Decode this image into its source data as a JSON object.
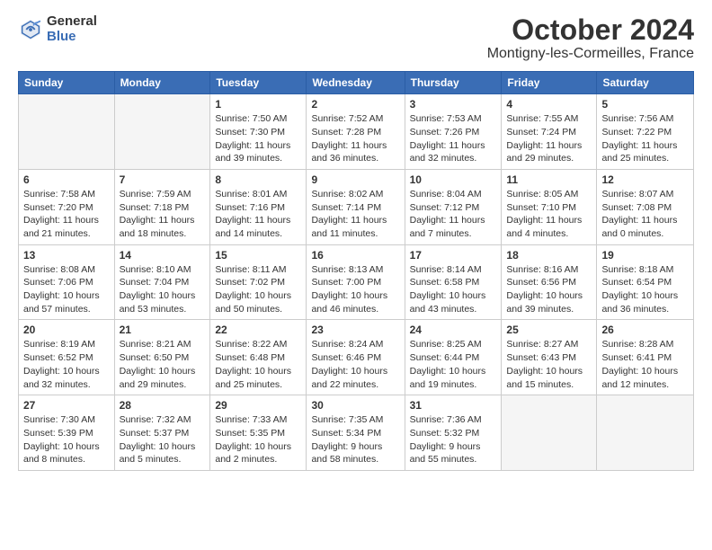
{
  "logo": {
    "general": "General",
    "blue": "Blue"
  },
  "header": {
    "month": "October 2024",
    "location": "Montigny-les-Cormeilles, France"
  },
  "weekdays": [
    "Sunday",
    "Monday",
    "Tuesday",
    "Wednesday",
    "Thursday",
    "Friday",
    "Saturday"
  ],
  "weeks": [
    [
      {
        "day": "",
        "info": ""
      },
      {
        "day": "",
        "info": ""
      },
      {
        "day": "1",
        "info": "Sunrise: 7:50 AM\nSunset: 7:30 PM\nDaylight: 11 hours and 39 minutes."
      },
      {
        "day": "2",
        "info": "Sunrise: 7:52 AM\nSunset: 7:28 PM\nDaylight: 11 hours and 36 minutes."
      },
      {
        "day": "3",
        "info": "Sunrise: 7:53 AM\nSunset: 7:26 PM\nDaylight: 11 hours and 32 minutes."
      },
      {
        "day": "4",
        "info": "Sunrise: 7:55 AM\nSunset: 7:24 PM\nDaylight: 11 hours and 29 minutes."
      },
      {
        "day": "5",
        "info": "Sunrise: 7:56 AM\nSunset: 7:22 PM\nDaylight: 11 hours and 25 minutes."
      }
    ],
    [
      {
        "day": "6",
        "info": "Sunrise: 7:58 AM\nSunset: 7:20 PM\nDaylight: 11 hours and 21 minutes."
      },
      {
        "day": "7",
        "info": "Sunrise: 7:59 AM\nSunset: 7:18 PM\nDaylight: 11 hours and 18 minutes."
      },
      {
        "day": "8",
        "info": "Sunrise: 8:01 AM\nSunset: 7:16 PM\nDaylight: 11 hours and 14 minutes."
      },
      {
        "day": "9",
        "info": "Sunrise: 8:02 AM\nSunset: 7:14 PM\nDaylight: 11 hours and 11 minutes."
      },
      {
        "day": "10",
        "info": "Sunrise: 8:04 AM\nSunset: 7:12 PM\nDaylight: 11 hours and 7 minutes."
      },
      {
        "day": "11",
        "info": "Sunrise: 8:05 AM\nSunset: 7:10 PM\nDaylight: 11 hours and 4 minutes."
      },
      {
        "day": "12",
        "info": "Sunrise: 8:07 AM\nSunset: 7:08 PM\nDaylight: 11 hours and 0 minutes."
      }
    ],
    [
      {
        "day": "13",
        "info": "Sunrise: 8:08 AM\nSunset: 7:06 PM\nDaylight: 10 hours and 57 minutes."
      },
      {
        "day": "14",
        "info": "Sunrise: 8:10 AM\nSunset: 7:04 PM\nDaylight: 10 hours and 53 minutes."
      },
      {
        "day": "15",
        "info": "Sunrise: 8:11 AM\nSunset: 7:02 PM\nDaylight: 10 hours and 50 minutes."
      },
      {
        "day": "16",
        "info": "Sunrise: 8:13 AM\nSunset: 7:00 PM\nDaylight: 10 hours and 46 minutes."
      },
      {
        "day": "17",
        "info": "Sunrise: 8:14 AM\nSunset: 6:58 PM\nDaylight: 10 hours and 43 minutes."
      },
      {
        "day": "18",
        "info": "Sunrise: 8:16 AM\nSunset: 6:56 PM\nDaylight: 10 hours and 39 minutes."
      },
      {
        "day": "19",
        "info": "Sunrise: 8:18 AM\nSunset: 6:54 PM\nDaylight: 10 hours and 36 minutes."
      }
    ],
    [
      {
        "day": "20",
        "info": "Sunrise: 8:19 AM\nSunset: 6:52 PM\nDaylight: 10 hours and 32 minutes."
      },
      {
        "day": "21",
        "info": "Sunrise: 8:21 AM\nSunset: 6:50 PM\nDaylight: 10 hours and 29 minutes."
      },
      {
        "day": "22",
        "info": "Sunrise: 8:22 AM\nSunset: 6:48 PM\nDaylight: 10 hours and 25 minutes."
      },
      {
        "day": "23",
        "info": "Sunrise: 8:24 AM\nSunset: 6:46 PM\nDaylight: 10 hours and 22 minutes."
      },
      {
        "day": "24",
        "info": "Sunrise: 8:25 AM\nSunset: 6:44 PM\nDaylight: 10 hours and 19 minutes."
      },
      {
        "day": "25",
        "info": "Sunrise: 8:27 AM\nSunset: 6:43 PM\nDaylight: 10 hours and 15 minutes."
      },
      {
        "day": "26",
        "info": "Sunrise: 8:28 AM\nSunset: 6:41 PM\nDaylight: 10 hours and 12 minutes."
      }
    ],
    [
      {
        "day": "27",
        "info": "Sunrise: 7:30 AM\nSunset: 5:39 PM\nDaylight: 10 hours and 8 minutes."
      },
      {
        "day": "28",
        "info": "Sunrise: 7:32 AM\nSunset: 5:37 PM\nDaylight: 10 hours and 5 minutes."
      },
      {
        "day": "29",
        "info": "Sunrise: 7:33 AM\nSunset: 5:35 PM\nDaylight: 10 hours and 2 minutes."
      },
      {
        "day": "30",
        "info": "Sunrise: 7:35 AM\nSunset: 5:34 PM\nDaylight: 9 hours and 58 minutes."
      },
      {
        "day": "31",
        "info": "Sunrise: 7:36 AM\nSunset: 5:32 PM\nDaylight: 9 hours and 55 minutes."
      },
      {
        "day": "",
        "info": ""
      },
      {
        "day": "",
        "info": ""
      }
    ]
  ]
}
